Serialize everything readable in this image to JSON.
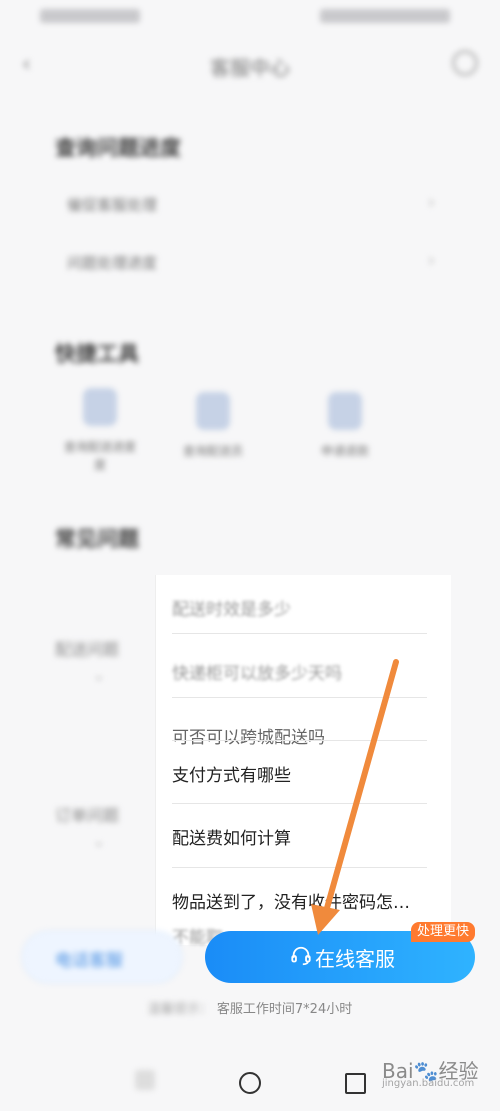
{
  "header": {
    "title": "客服中心"
  },
  "sections": {
    "my_issues": "查询问题进度",
    "my_issue_items": [
      "催促客服处理",
      "问题处理进度"
    ],
    "self_service": "快捷工具",
    "tools": [
      {
        "label": "查询配送进度",
        "sub": "度"
      },
      {
        "label": "查询配送员"
      },
      {
        "label": "申请退款"
      }
    ],
    "faq": "常见问题",
    "categories": [
      "配送问题",
      "订单问题"
    ]
  },
  "qa": {
    "blurred_items": [
      "配送时效是多少",
      "快递柜可以放多少天吗"
    ],
    "partial_item": "可否可以跨城配送吗",
    "items": [
      "支付方式有哪些",
      "配送费如何计算",
      "物品送到了，没有收件密码怎…",
      "不能取，"
    ]
  },
  "buttons": {
    "call": "电话客服",
    "online": "在线客服",
    "fast_badge": "处理更快"
  },
  "tip": {
    "prefix": "温馨提示：",
    "text": "客服工作时间7*24小时"
  },
  "watermark": {
    "brand": "Bai",
    "brand2": "经验",
    "url": "jingyan.baidu.com"
  },
  "colors": {
    "primary": "#1a8cf7",
    "badge": "#ff7a2f",
    "annotation_arrow": "#f08a3c"
  }
}
